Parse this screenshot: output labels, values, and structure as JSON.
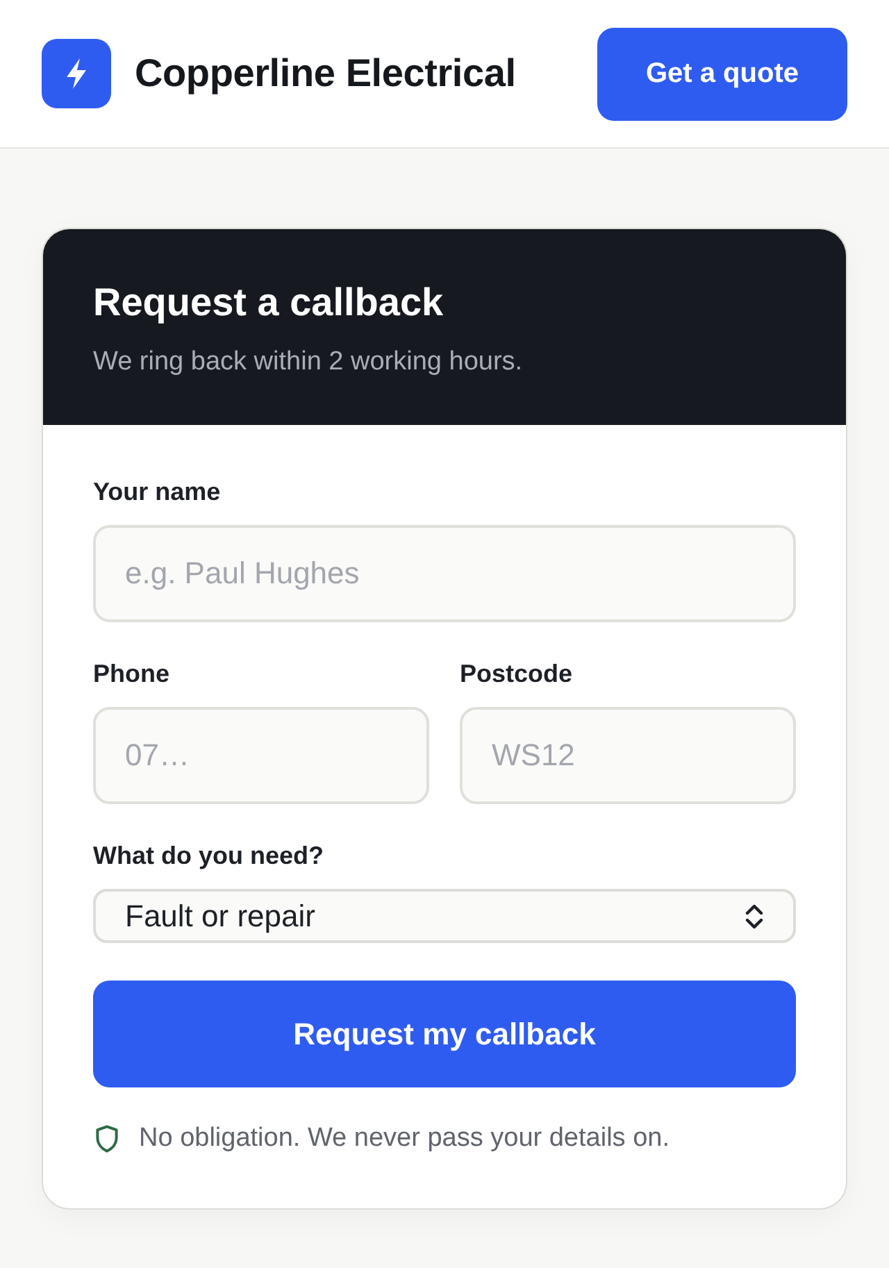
{
  "header": {
    "brand": "Copperline Electrical",
    "quote_button": "Get a quote"
  },
  "callback_form": {
    "title": "Request a callback",
    "subtitle": "We ring back within 2 working hours.",
    "rows": [
      [
        {
          "kind": "input",
          "label": "Your name",
          "placeholder": "e.g. Paul Hughes"
        }
      ],
      [
        {
          "kind": "input",
          "label": "Phone",
          "placeholder": "07…"
        },
        {
          "kind": "input",
          "label": "Postcode",
          "placeholder": "WS12"
        }
      ],
      [
        {
          "kind": "select",
          "label": "What do you need?",
          "value": "Fault or repair"
        }
      ]
    ],
    "submit_button": "Request my callback",
    "note": "No obligation. We never pass your details on."
  }
}
